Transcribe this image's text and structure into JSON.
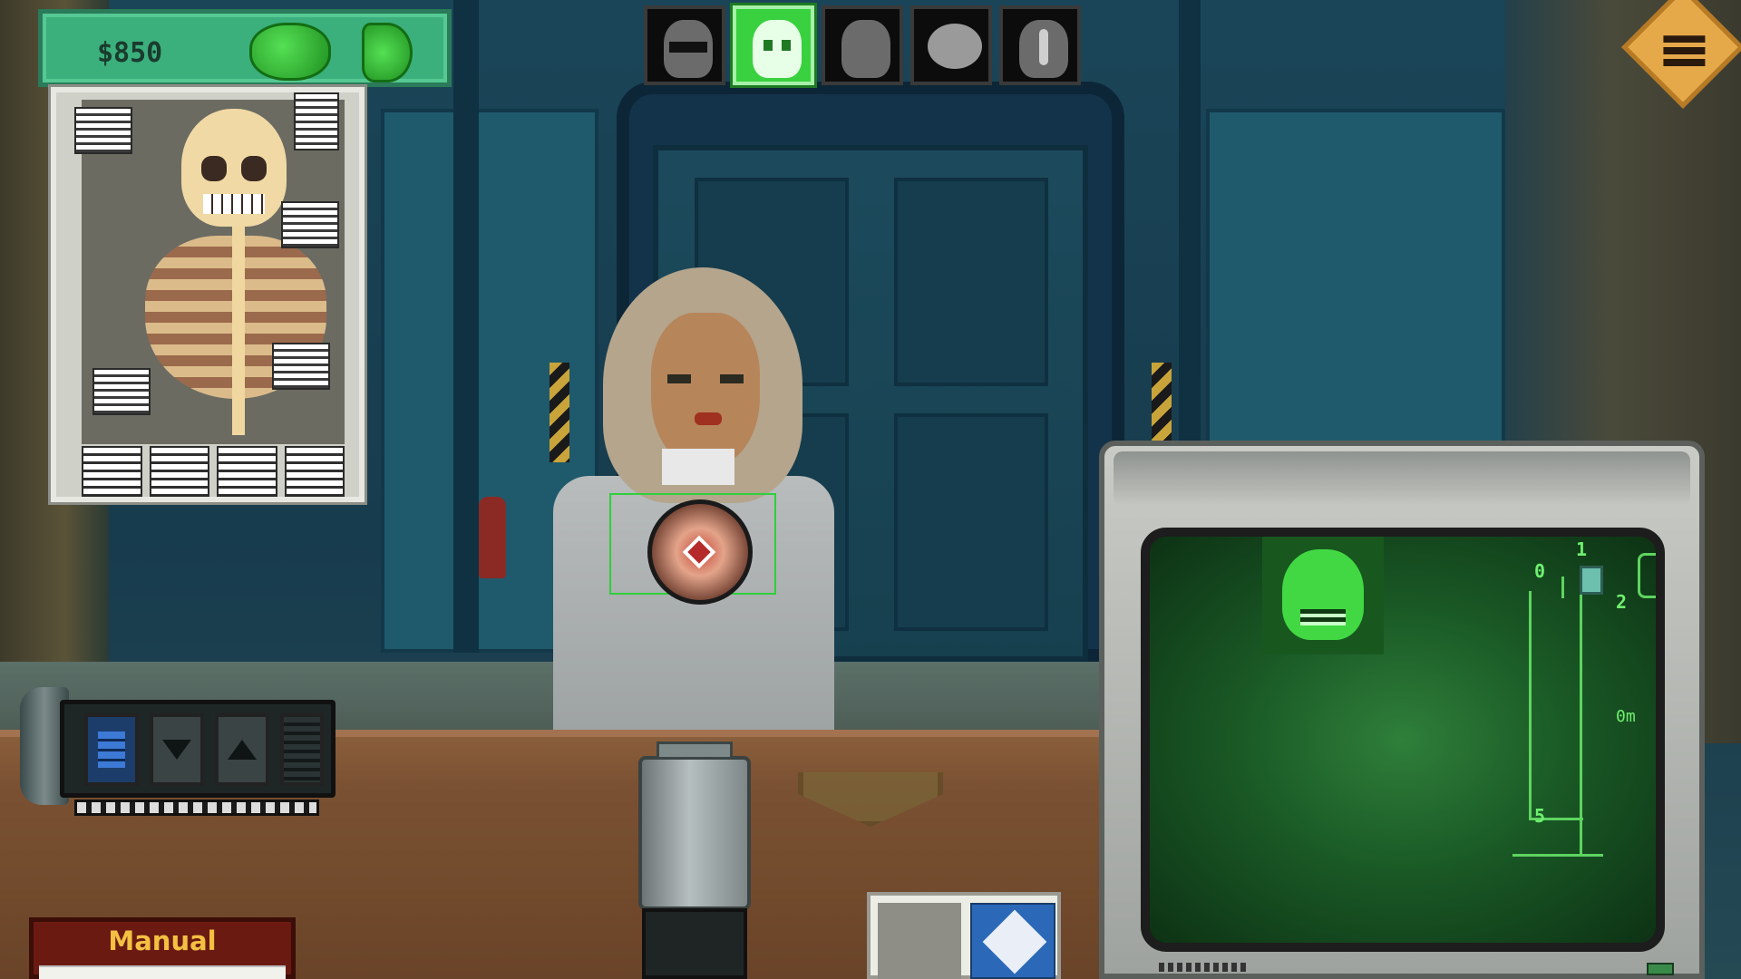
{
  "hud": {
    "money": "$850",
    "organs": [
      "brain-icon",
      "stomach-icon"
    ]
  },
  "scan_tabs": [
    {
      "name": "visor-scan",
      "icon": "visor-face-icon",
      "active": false
    },
    {
      "name": "xray-scan",
      "icon": "skull-icon",
      "active": true
    },
    {
      "name": "silhouette-scan",
      "icon": "head-silhouette-icon",
      "active": false
    },
    {
      "name": "brain-scan",
      "icon": "brain-icon",
      "active": false
    },
    {
      "name": "temperature-scan",
      "icon": "thermometer-icon",
      "active": false
    }
  ],
  "menu": {
    "icon": "hamburger-menu-icon"
  },
  "manual": {
    "title": "Manual"
  },
  "monitor": {
    "floors": [
      "1",
      "0",
      "2",
      "5"
    ],
    "distance": "0m"
  },
  "colors": {
    "accent_green": "#39d13f",
    "money_panel": "#3bb07c",
    "manual_title": "#f3c042"
  }
}
